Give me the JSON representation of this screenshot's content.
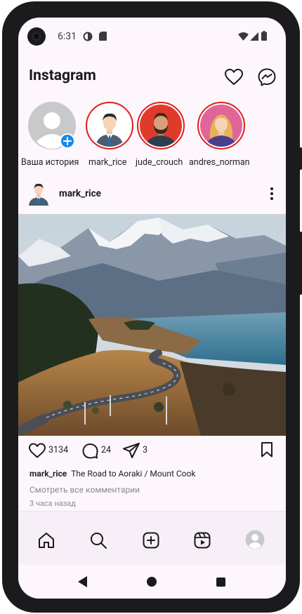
{
  "status": {
    "time": "6:31"
  },
  "header": {
    "title": "Instagram"
  },
  "stories": [
    {
      "label": "Ваша история",
      "avatar": "own-story-placeholder"
    },
    {
      "label": "mark_rice",
      "avatar": "man-in-suit-avatar"
    },
    {
      "label": "jude_crouch",
      "avatar": "bearded-man-avatar"
    },
    {
      "label": "andres_norman",
      "avatar": "woman-avatar"
    }
  ],
  "post": {
    "username": "mark_rice",
    "likes": "3134",
    "comments_count": "24",
    "shares": "3",
    "caption_user": "mark_rice",
    "caption_text": "The Road to Aoraki / Mount Cook",
    "view_comments": "Смотреть все комментарии",
    "time_ago": "3 часа назад"
  },
  "colors": {
    "story_ring": "#e0201a",
    "screen_bg": "#fdf7fd",
    "nav_bg": "#f7eff7",
    "add_badge": "#1e88e5"
  }
}
